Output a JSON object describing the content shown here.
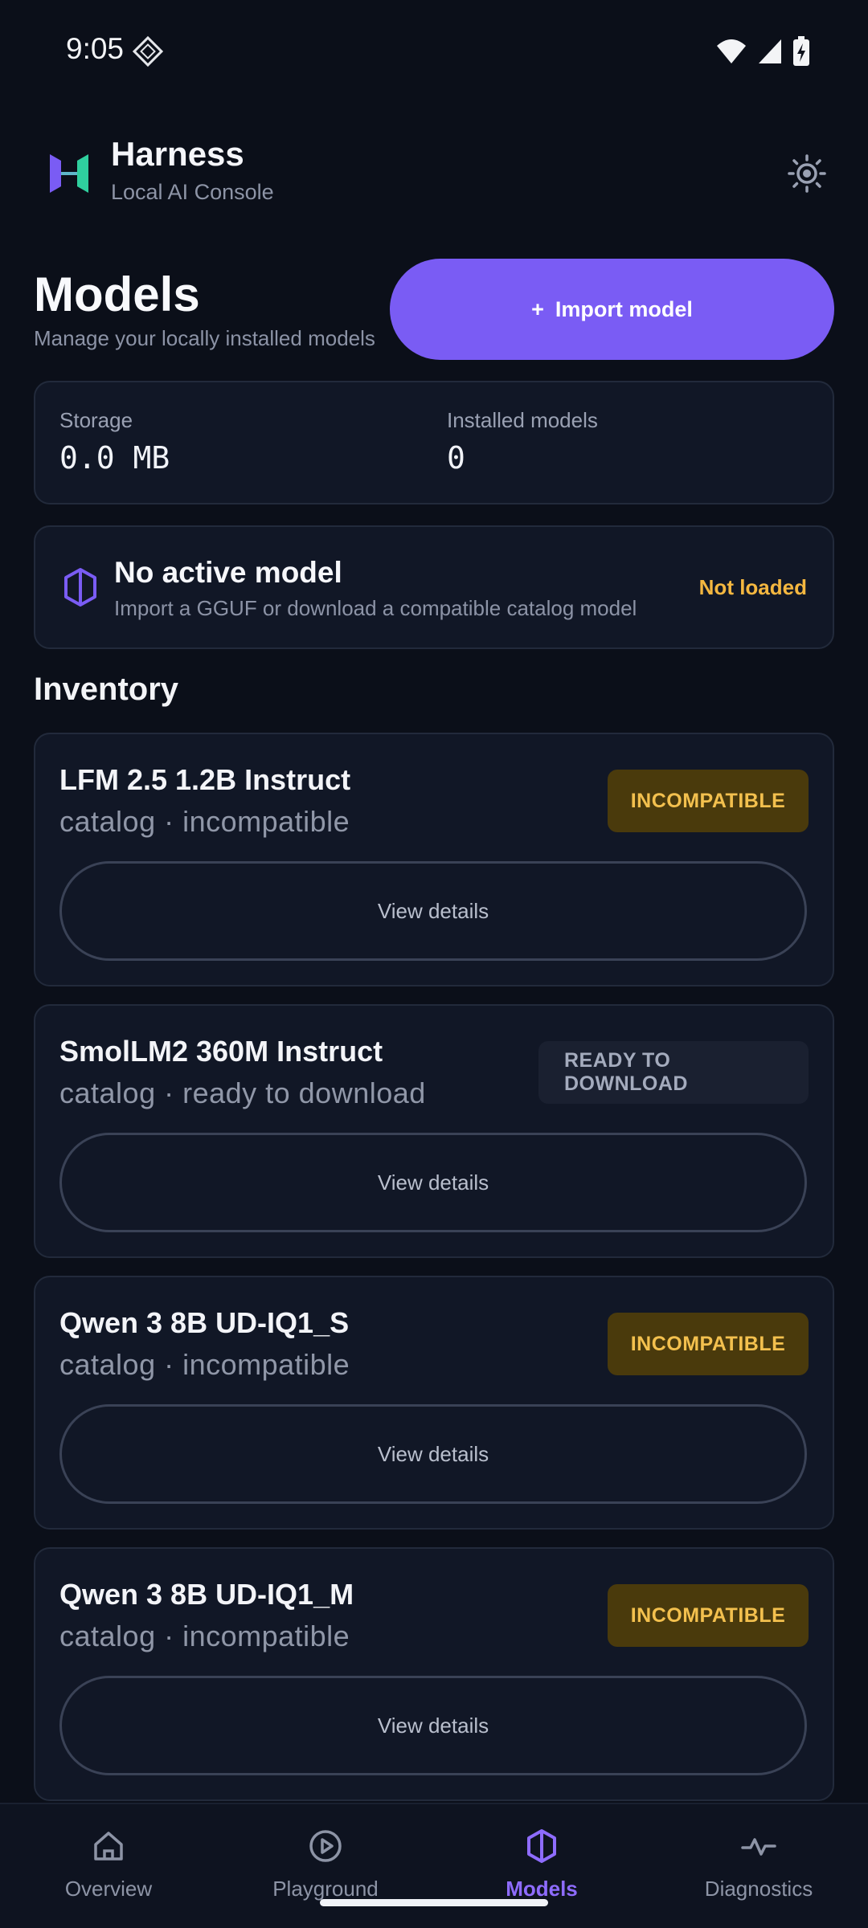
{
  "status_bar": {
    "time": "9:05"
  },
  "app": {
    "title": "Harness",
    "subtitle": "Local AI Console"
  },
  "page": {
    "title": "Models",
    "subtitle": "Manage your locally installed models",
    "import_label": "Import model",
    "import_icon": "+"
  },
  "stats": {
    "storage_label": "Storage",
    "storage_value": "0.0 MB",
    "installed_label": "Installed models",
    "installed_value": "0"
  },
  "active_model": {
    "title": "No active model",
    "description": "Import a GGUF or download a compatible catalog model",
    "status": "Not loaded"
  },
  "inventory": {
    "title": "Inventory",
    "models": [
      {
        "name": "LFM 2.5 1.2B Instruct",
        "meta": "catalog · incompatible",
        "badge": "INCOMPATIBLE",
        "action": "View details"
      },
      {
        "name": "SmolLM2 360M Instruct",
        "meta": "catalog · ready to download",
        "badge": "READY TO DOWNLOAD",
        "action": "View details"
      },
      {
        "name": "Qwen 3 8B UD-IQ1_S",
        "meta": "catalog · incompatible",
        "badge": "INCOMPATIBLE",
        "action": "View details"
      },
      {
        "name": "Qwen 3 8B UD-IQ1_M",
        "meta": "catalog · incompatible",
        "badge": "INCOMPATIBLE",
        "action": "View details"
      }
    ]
  },
  "nav": {
    "items": [
      {
        "label": "Overview",
        "icon": "home-icon"
      },
      {
        "label": "Playground",
        "icon": "play-icon"
      },
      {
        "label": "Models",
        "icon": "hexagon-icon",
        "active": true
      },
      {
        "label": "Diagnostics",
        "icon": "activity-icon"
      }
    ]
  },
  "colors": {
    "background": "#0b0f19",
    "accent": "#7a5cf4",
    "warning": "#f4b740",
    "card": "#111726"
  }
}
